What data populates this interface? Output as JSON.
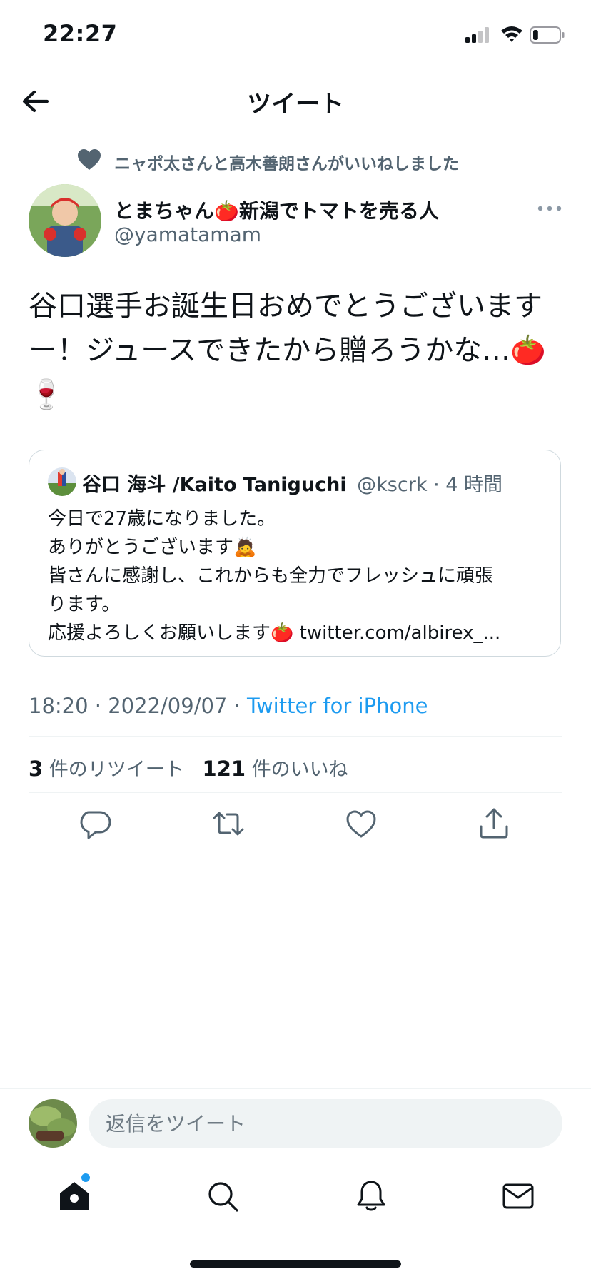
{
  "status_bar": {
    "time": "22:27",
    "battery_level": 0.2
  },
  "header": {
    "title": "ツイート"
  },
  "social_context": "ニャポ太さんと高木善朗さんがいいねしました",
  "author": {
    "display_name": "とまちゃん🍅新潟でトマトを売る人",
    "handle": "@yamatamam"
  },
  "tweet": {
    "text": "谷口選手お誕生日おめでとうございます\nー！ジュースできたから贈ろうかな…🍅\n🍷"
  },
  "quote": {
    "name": "谷口 海斗 /Kaito Taniguchi",
    "handle": "@kscrk",
    "time": "· 4 時間",
    "body": "今日で27歳になりました。\nありがとうございます🙇\n皆さんに感謝し、これからも全力でフレッシュに頑張\nります。\n応援よろしくお願いします🍅 twitter.com/albirex_..."
  },
  "meta": {
    "time_date": "18:20 · 2022/09/07 · ",
    "source": "Twitter for iPhone"
  },
  "stats": {
    "retweets_count": "3",
    "retweets_label": "件のリツイート",
    "likes_count": "121",
    "likes_label": "件のいいね"
  },
  "reply": {
    "placeholder": "返信をツイート"
  },
  "icons": {
    "back": "arrow-left-icon",
    "more": "more-icon",
    "reply": "reply-icon",
    "retweet": "retweet-icon",
    "like": "heart-icon",
    "share": "share-icon",
    "home": "home-icon",
    "search": "search-icon",
    "notifications": "bell-icon",
    "messages": "mail-icon"
  },
  "colors": {
    "link": "#1d9bf0",
    "secondary_text": "#536471",
    "primary_text": "#0f1419"
  }
}
